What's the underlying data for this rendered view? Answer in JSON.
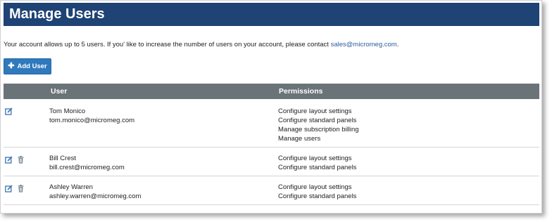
{
  "header": {
    "title": "Manage Users"
  },
  "intro": {
    "text": "Your account allows up to 5 users. If you' like to increase the number of users on your account, please contact ",
    "email": "sales@micromeg.com",
    "trailing": "."
  },
  "add_user_button": {
    "label": "Add User",
    "icon": "plus-icon"
  },
  "table": {
    "headers": {
      "user": "User",
      "permissions": "Permissions"
    },
    "rows": [
      {
        "name": "Tom Monico",
        "email": "tom.monico@micromeg.com",
        "can_delete": false,
        "permissions": [
          "Configure layout settings",
          "Configure standard panels",
          "Manage subscription billing",
          "Manage users"
        ]
      },
      {
        "name": "Bill Crest",
        "email": "bill.crest@micromeg.com",
        "can_delete": true,
        "permissions": [
          "Configure layout settings",
          "Configure standard panels"
        ]
      },
      {
        "name": "Ashley Warren",
        "email": "ashley.warren@micromeg.com",
        "can_delete": true,
        "permissions": [
          "Configure layout settings",
          "Configure standard panels"
        ]
      }
    ]
  },
  "colors": {
    "header_bg": "#1e4374",
    "button_bg": "#2f79bd",
    "table_header_bg": "#6a7378",
    "link": "#2a5d9c",
    "icon": "#3b73b0"
  }
}
